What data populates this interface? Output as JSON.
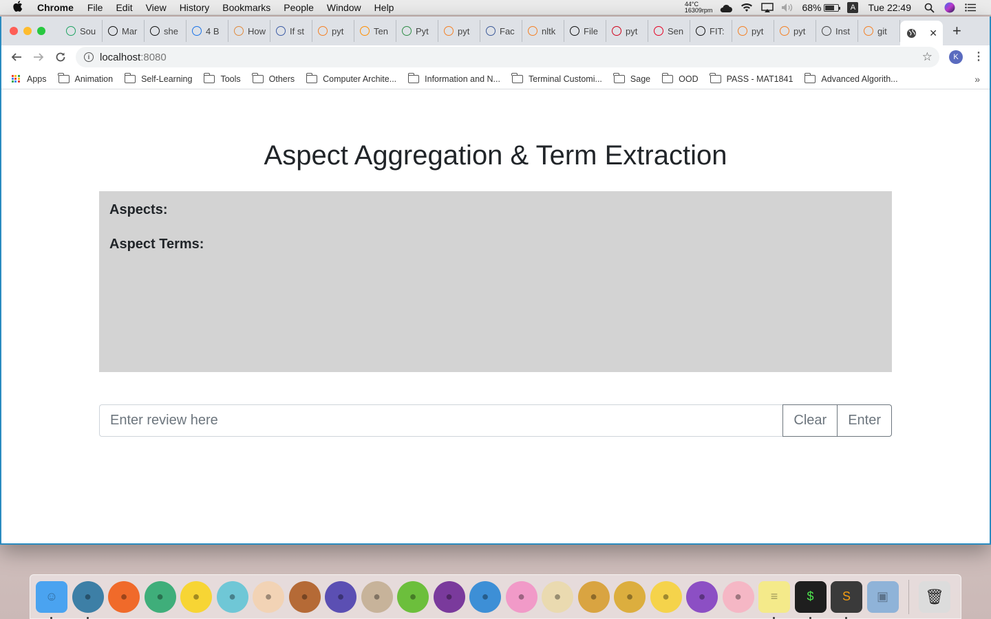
{
  "menubar": {
    "app": "Chrome",
    "menus": [
      "File",
      "Edit",
      "View",
      "History",
      "Bookmarks",
      "People",
      "Window",
      "Help"
    ],
    "temp_line1": "44°C",
    "temp_line2": "16309rpm",
    "battery": "68%",
    "battery_level": 0.68,
    "input_source": "A",
    "clock": "Tue 22:49"
  },
  "tabs": [
    {
      "label": "Sou",
      "icon": "google-drive-icon",
      "color": "#1fa463"
    },
    {
      "label": "Mar",
      "icon": "github-icon",
      "color": "#111111"
    },
    {
      "label": "she",
      "icon": "github-icon",
      "color": "#111111"
    },
    {
      "label": "4 B",
      "icon": "table-icon",
      "color": "#1a73e8"
    },
    {
      "label": "How",
      "icon": "site-icon",
      "color": "#e08a3c"
    },
    {
      "label": "If st",
      "icon": "site-icon",
      "color": "#3b5ba5"
    },
    {
      "label": "pyt",
      "icon": "stackoverflow-icon",
      "color": "#f48024"
    },
    {
      "label": "Ten",
      "icon": "tensorflow-icon",
      "color": "#ff8f00"
    },
    {
      "label": "Pyt",
      "icon": "geeksforgeeks-icon",
      "color": "#2f8d46"
    },
    {
      "label": "pyt",
      "icon": "stackoverflow-icon",
      "color": "#f48024"
    },
    {
      "label": "Fac",
      "icon": "facebook-icon",
      "color": "#3b5998"
    },
    {
      "label": "nltk",
      "icon": "stackoverflow-icon",
      "color": "#f48024"
    },
    {
      "label": "File",
      "icon": "github-icon",
      "color": "#111111"
    },
    {
      "label": "pyt",
      "icon": "site-icon",
      "color": "#d0021b"
    },
    {
      "label": "Sen",
      "icon": "site-icon",
      "color": "#e60023"
    },
    {
      "label": "FIT:",
      "icon": "github-icon",
      "color": "#111111"
    },
    {
      "label": "pyt",
      "icon": "stackoverflow-icon",
      "color": "#f48024"
    },
    {
      "label": "pyt",
      "icon": "stackoverflow-icon",
      "color": "#f48024"
    },
    {
      "label": "Inst",
      "icon": "document-icon",
      "color": "#444444"
    },
    {
      "label": "git",
      "icon": "stackoverflow-icon",
      "color": "#f48024"
    }
  ],
  "omnibox": {
    "host": "localhost",
    "port": ":8080"
  },
  "profile_initial": "K",
  "bookmarks": {
    "apps": "Apps",
    "items": [
      "Animation",
      "Self-Learning",
      "Tools",
      "Others",
      "Computer Archite...",
      "Information and N...",
      "Terminal Customi...",
      "Sage",
      "OOD",
      "PASS - MAT1841",
      "Advanced Algorith..."
    ],
    "more": "»"
  },
  "page": {
    "title": "Aspect Aggregation & Term Extraction",
    "aspects_label": "Aspects:",
    "aspect_terms_label": "Aspect Terms:",
    "review_placeholder": "Enter review here",
    "clear_label": "Clear",
    "enter_label": "Enter",
    "results_bg": "#d3d3d3"
  },
  "dock": {
    "items": [
      {
        "name": "finder-icon",
        "bg": "#4aa3f0",
        "glyph": "☺",
        "running": true
      },
      {
        "name": "snorlax-icon",
        "bg": "#3d7fa6",
        "glyph": "●",
        "running": true
      },
      {
        "name": "charmander-icon",
        "bg": "#f06a2a",
        "glyph": "●",
        "running": false
      },
      {
        "name": "bulbasaur-icon",
        "bg": "#3fae7a",
        "glyph": "●",
        "running": false
      },
      {
        "name": "pikachu-icon",
        "bg": "#f7d534",
        "glyph": "●",
        "running": false
      },
      {
        "name": "squirtle-icon",
        "bg": "#6fc7d6",
        "glyph": "●",
        "running": false
      },
      {
        "name": "mankey-icon",
        "bg": "#f2d3b5",
        "glyph": "●",
        "running": false
      },
      {
        "name": "eevee-icon",
        "bg": "#b56a36",
        "glyph": "●",
        "running": false
      },
      {
        "name": "zubat-icon",
        "bg": "#5b4fb3",
        "glyph": "●",
        "running": false
      },
      {
        "name": "shellder-icon",
        "bg": "#c7b39a",
        "glyph": "●",
        "running": false
      },
      {
        "name": "natu-icon",
        "bg": "#6cbf3c",
        "glyph": "●",
        "running": false
      },
      {
        "name": "grimer-icon",
        "bg": "#7a3a9c",
        "glyph": "●",
        "running": false
      },
      {
        "name": "dratini-icon",
        "bg": "#3d8fd6",
        "glyph": "●",
        "running": false
      },
      {
        "name": "jigglypuff-icon",
        "bg": "#f19ac8",
        "glyph": "●",
        "running": false
      },
      {
        "name": "meowth-icon",
        "bg": "#eadab0",
        "glyph": "●",
        "running": false
      },
      {
        "name": "abra-icon",
        "bg": "#d9a441",
        "glyph": "●",
        "running": false
      },
      {
        "name": "kadabra-icon",
        "bg": "#dcae3e",
        "glyph": "●",
        "running": false
      },
      {
        "name": "psyduck-icon",
        "bg": "#f5d34b",
        "glyph": "●",
        "running": false
      },
      {
        "name": "rattata-icon",
        "bg": "#8c4fc4",
        "glyph": "●",
        "running": false
      },
      {
        "name": "mew-icon",
        "bg": "#f5b7c5",
        "glyph": "●",
        "running": false
      },
      {
        "name": "stickies-icon",
        "bg": "#f4ea8a",
        "glyph": "≡",
        "running": true
      },
      {
        "name": "terminal-icon",
        "bg": "#1e1e1e",
        "glyph": "$",
        "running": true
      },
      {
        "name": "sublime-text-icon",
        "bg": "#3a3a3a",
        "glyph": "S",
        "running": true
      },
      {
        "name": "preview-icon",
        "bg": "#8fb3d8",
        "glyph": "▣",
        "running": false
      }
    ],
    "trash": {
      "name": "trash-icon",
      "bg": "#dcdcdc",
      "glyph": "🗑"
    }
  }
}
